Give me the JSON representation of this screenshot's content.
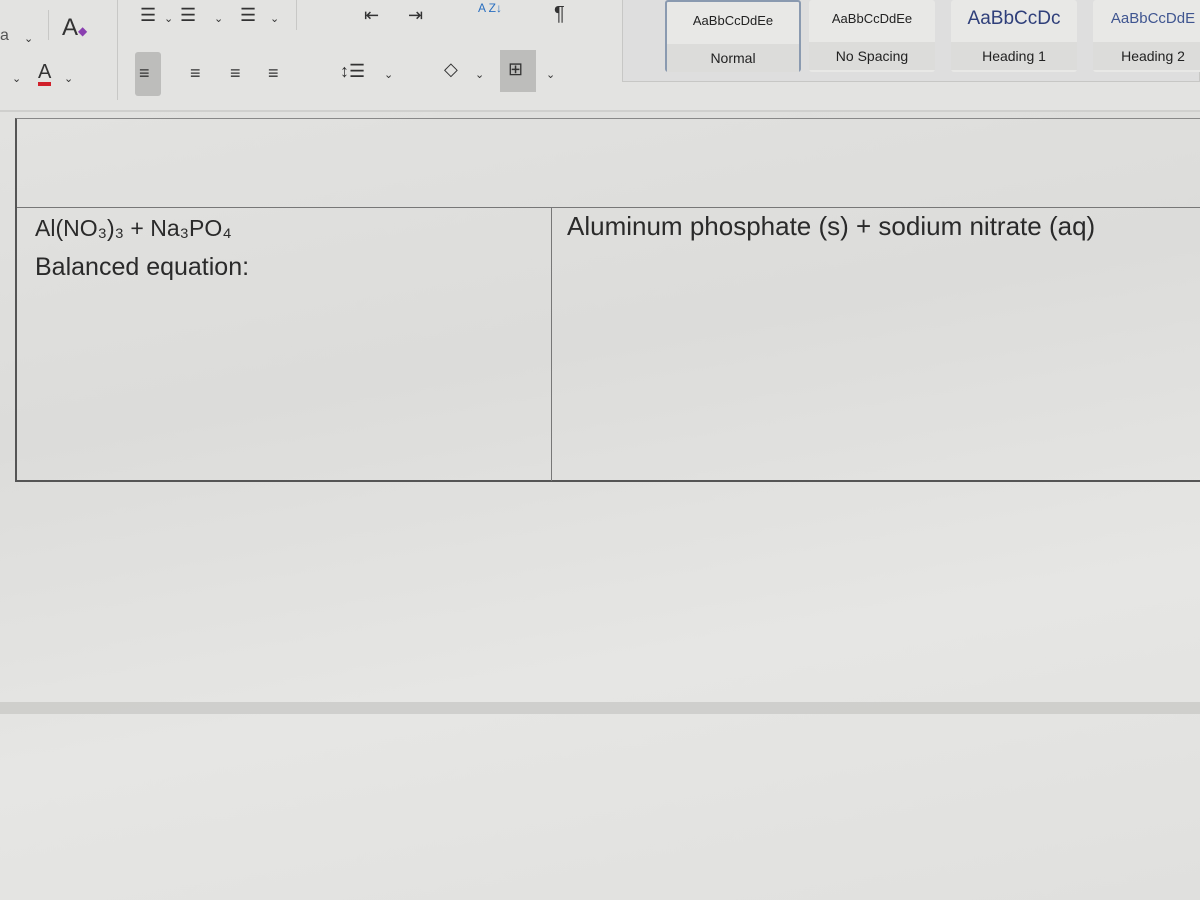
{
  "ribbon": {
    "font_fragment": "a",
    "icons": [
      "clear-formatting-icon",
      "bullets-icon",
      "numbering-icon",
      "multilevel-list-icon",
      "decrease-indent-icon",
      "increase-indent-icon",
      "sort-icon",
      "show-formatting-icon",
      "font-color-icon",
      "align-left-icon",
      "align-center-icon",
      "align-right-icon",
      "justify-icon",
      "line-spacing-icon",
      "shading-icon",
      "borders-icon"
    ],
    "font_color": "#d0202a",
    "font_color_letter": "A",
    "pilcrow": "¶",
    "sort_glyph": "A Z↓"
  },
  "styles": [
    {
      "sample": "AaBbCcDdEe",
      "label": "Normal",
      "selected": true
    },
    {
      "sample": "AaBbCcDdEe",
      "label": "No Spacing"
    },
    {
      "sample": "AaBbCcDc",
      "label": "Heading 1",
      "color": "#2f3f7a"
    },
    {
      "sample": "AaBbCcDdE",
      "label": "Heading 2",
      "color": "#3f5590"
    }
  ],
  "document": {
    "reactants": "Al(NO₃)₃ + Na₃PO₄",
    "balanced_label": "Balanced equation:",
    "products": "Aluminum phosphate (s) + sodium nitrate (aq)"
  }
}
